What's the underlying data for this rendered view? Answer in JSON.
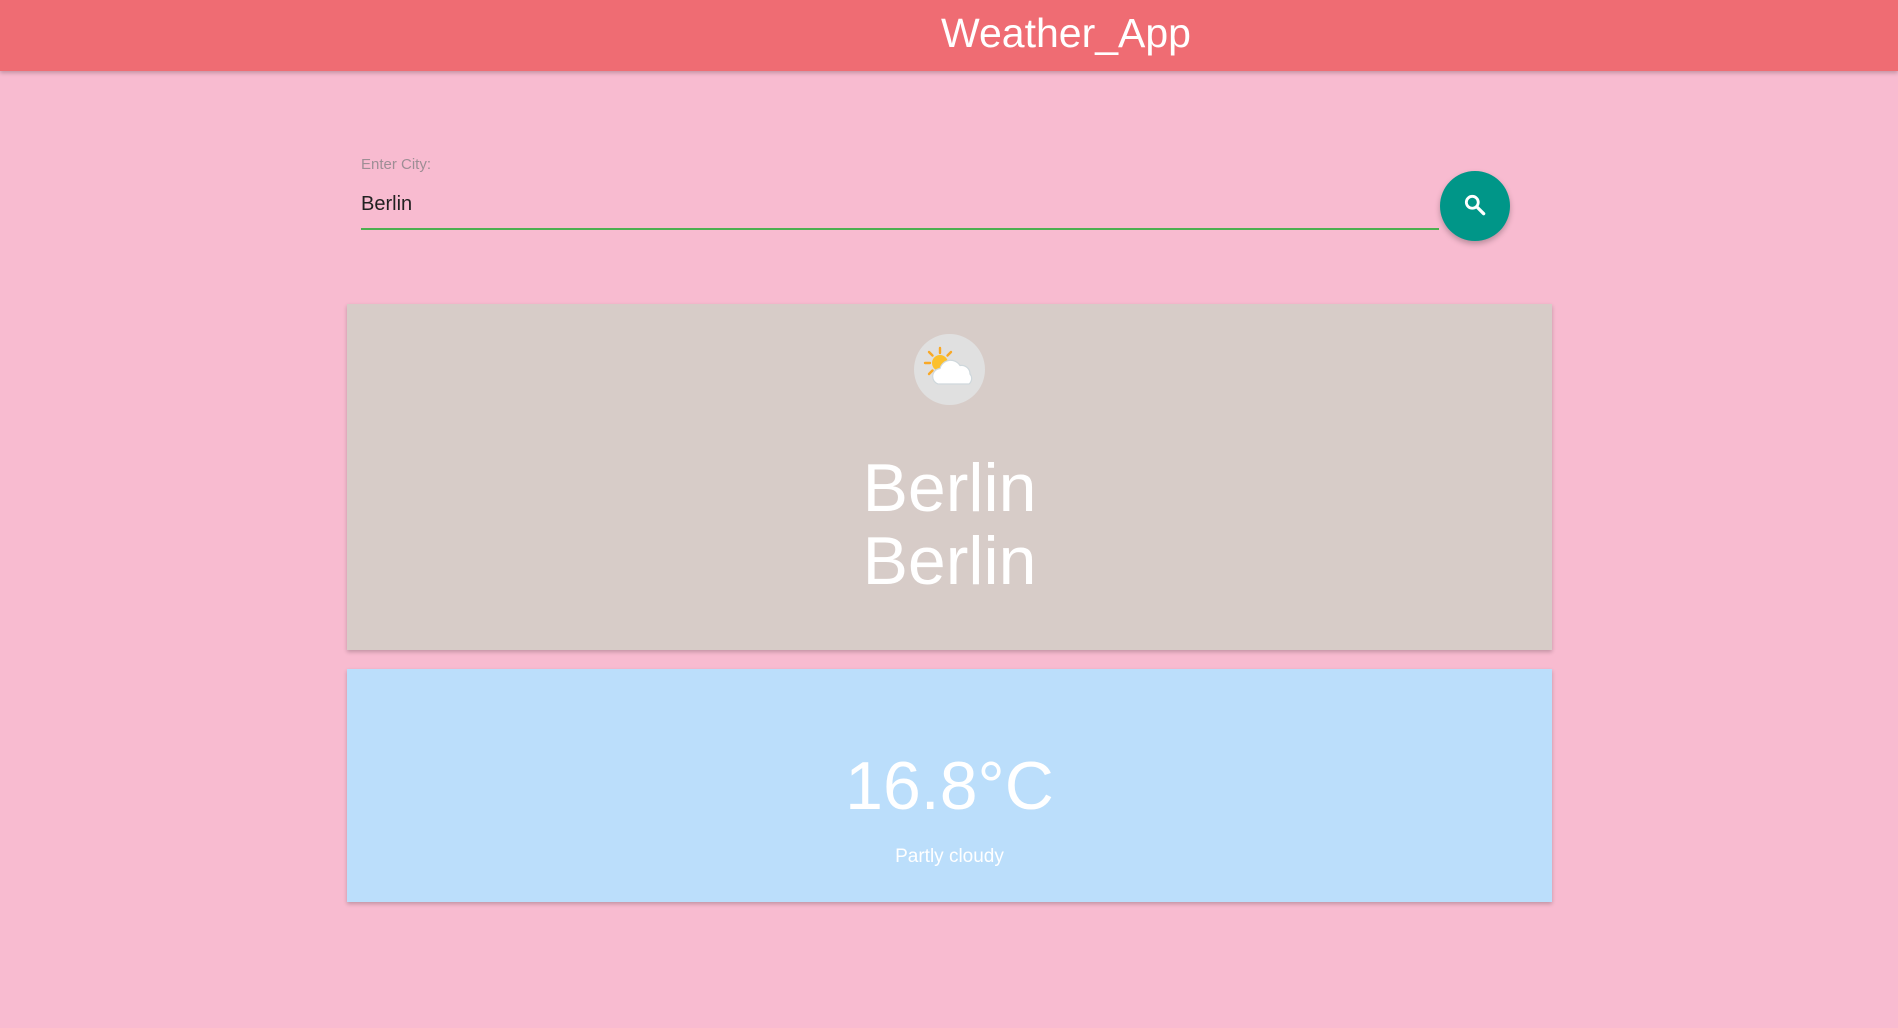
{
  "app": {
    "title": "Weather_App"
  },
  "search": {
    "label": "Enter City:",
    "value": "Berlin",
    "button_icon": "search-icon"
  },
  "location": {
    "icon": "partly-cloudy-icon",
    "name": "Berlin",
    "region": "Berlin"
  },
  "current": {
    "temperature": "16.8°C",
    "condition": "Partly cloudy"
  },
  "colors": {
    "background": "#f8bbd0",
    "app_bar": "#ef6c73",
    "location_card": "#d7ccc8",
    "temperature_card": "#bbdefb",
    "search_button": "#009688",
    "input_underline": "#4caf50"
  }
}
